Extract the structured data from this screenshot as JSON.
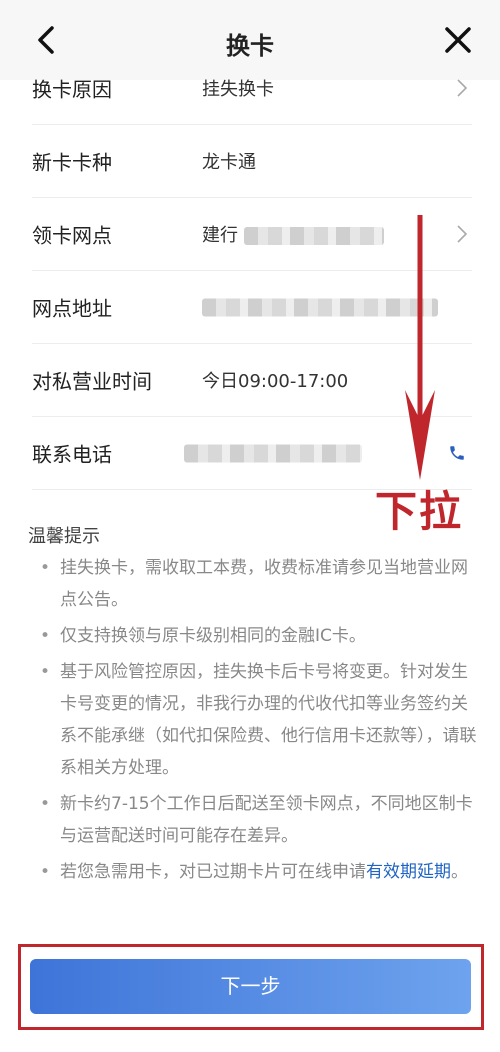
{
  "header": {
    "title": "换卡"
  },
  "form": {
    "rows": [
      {
        "label": "换卡原因",
        "value": "挂失换卡"
      },
      {
        "label": "新卡卡种",
        "value": "龙卡通"
      },
      {
        "label": "领卡网点",
        "value": "建行"
      },
      {
        "label": "网点地址",
        "value": ""
      },
      {
        "label": "对私营业时间",
        "value": "今日09:00-17:00"
      },
      {
        "label": "联系电话",
        "value": ""
      }
    ]
  },
  "annotation": {
    "pull_text": "下拉",
    "color": "#c0272d"
  },
  "tips": {
    "title": "温馨提示",
    "items": [
      "挂失换卡，需收取工本费，收费标准请参见当地营业网点公告。",
      "仅支持换领与原卡级别相同的金融IC卡。",
      "基于风险管控原因，挂失换卡后卡号将变更。针对发生卡号变更的情况，非我行办理的代收代扣等业务签约关系不能承继（如代扣保险费、他行信用卡还款等），请联系相关方处理。",
      "新卡约7-15个工作日后配送至领卡网点，不同地区制卡与运营配送时间可能存在差异。",
      "若您急需用卡，对已过期卡片可在线申请"
    ],
    "link_text": "有效期延期",
    "link_suffix": "。"
  },
  "footer": {
    "next_label": "下一步"
  },
  "colors": {
    "accent": "#3e74d8",
    "link": "#1f63c4",
    "annotation": "#c0272d"
  }
}
